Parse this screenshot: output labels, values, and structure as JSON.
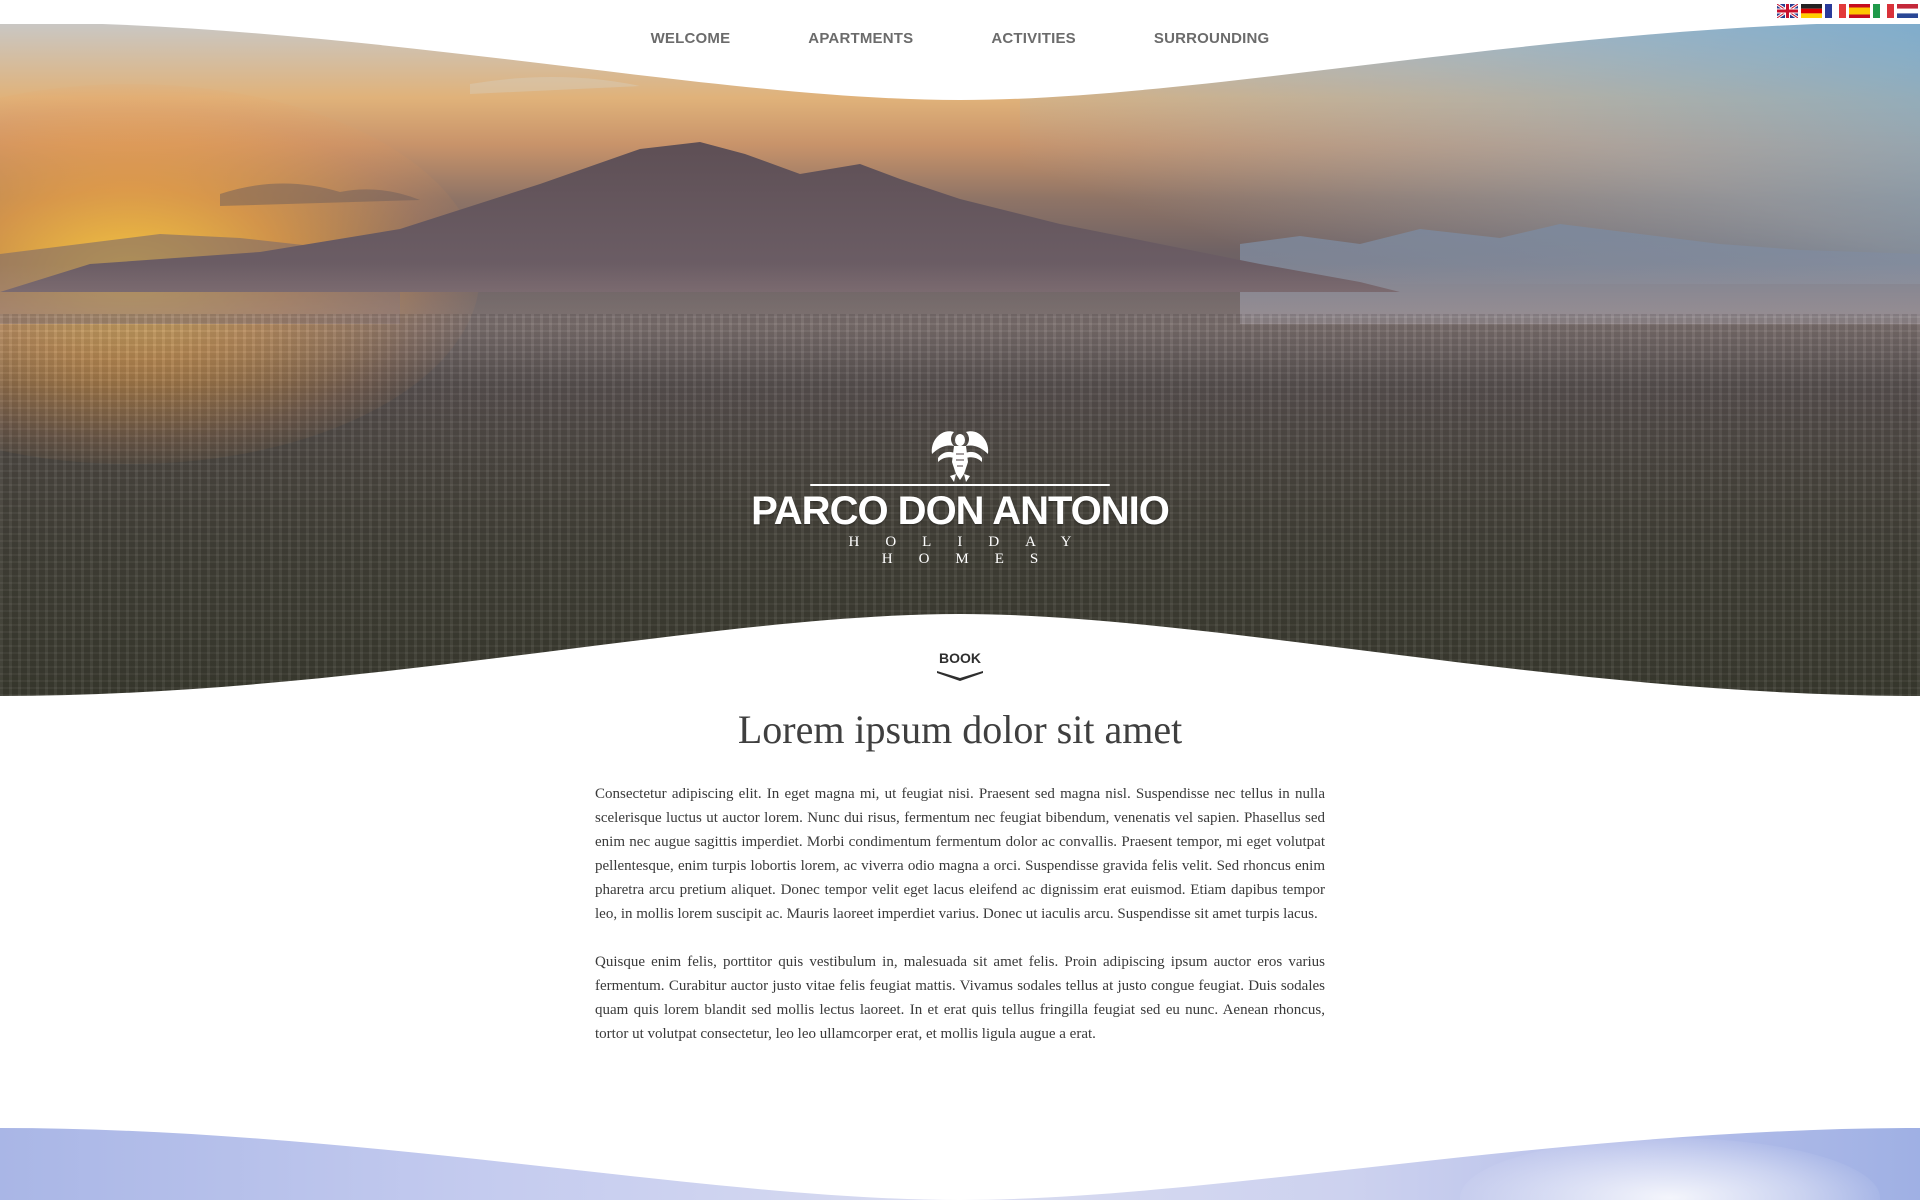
{
  "nav": {
    "items": [
      {
        "label": "WELCOME"
      },
      {
        "label": "APARTMENTS"
      },
      {
        "label": "ACTIVITIES"
      },
      {
        "label": "SURROUNDING"
      }
    ]
  },
  "languages": [
    {
      "name": "english-flag-icon"
    },
    {
      "name": "german-flag-icon"
    },
    {
      "name": "french-flag-icon"
    },
    {
      "name": "spanish-flag-icon"
    },
    {
      "name": "italian-flag-icon"
    },
    {
      "name": "dutch-flag-icon"
    }
  ],
  "logo": {
    "name": "PARCO DON ANTONIO",
    "tagline": "HOLIDAY HOMES",
    "emblem_icon": "eagle-emblem-icon"
  },
  "book": {
    "label": "BOOK",
    "icon": "chevron-down-icon"
  },
  "content": {
    "title": "Lorem ipsum dolor sit amet",
    "paragraph1": "Consectetur adipiscing elit. In eget magna mi, ut feugiat nisi. Praesent sed magna nisl. Suspendisse nec tellus in nulla scelerisque luctus ut auctor lorem. Nunc dui risus, fermentum nec feugiat bibendum, venenatis vel sapien. Phasellus sed enim nec augue sagittis imperdiet. Morbi condimentum fermentum dolor ac convallis. Praesent tempor, mi eget volutpat pellentesque, enim turpis lobortis lorem, ac viverra odio magna a orci. Suspendisse gravida felis velit. Sed rhoncus enim pharetra arcu pretium aliquet. Donec tempor velit eget lacus eleifend ac dignissim erat euismod. Etiam dapibus tempor leo, in mollis lorem suscipit ac. Mauris laoreet imperdiet varius. Donec ut iaculis arcu. Suspendisse sit amet turpis lacus.",
    "paragraph2": "Quisque enim felis, porttitor quis vestibulum in, malesuada sit amet felis. Proin adipiscing ipsum auctor eros varius fermentum. Curabitur auctor justo vitae felis feugiat mattis. Vivamus sodales tellus at justo congue feugiat. Duis sodales quam quis lorem blandit sed mollis lectus laoreet. In et erat quis tellus fringilla feugiat sed eu nunc. Aenean rhoncus, tortor ut volutpat consectetur, leo leo ullamcorper erat, et mollis ligula augue a erat."
  },
  "colors": {
    "nav_text": "#6b6b6b",
    "heading": "#3f3f3f",
    "body_text": "#3a3a3a",
    "logo_text": "#ffffff"
  }
}
